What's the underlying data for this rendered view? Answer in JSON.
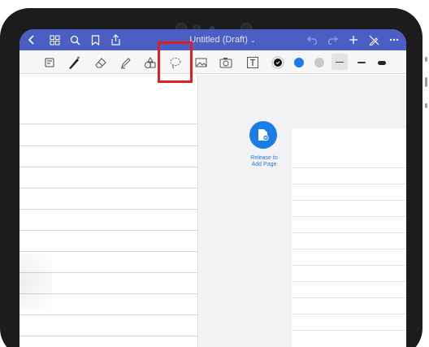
{
  "app": {
    "title": "Untitled (Draft)",
    "accent_color": "#4b5ec3",
    "highlight_color": "#e02020"
  },
  "nav_icons": {
    "back": "chevron-left-icon",
    "thumbnails": "grid-icon",
    "search": "search-icon",
    "bookmark": "bookmark-icon",
    "share": "share-icon"
  },
  "right_icons": {
    "undo": "undo-icon",
    "redo": "redo-icon",
    "add": "plus-icon",
    "edit_off": "pen-off-icon",
    "more": "more-icon"
  },
  "tools": [
    {
      "name": "reading-mode",
      "icon": "reading-mode-icon"
    },
    {
      "name": "pen",
      "icon": "pen-icon",
      "selected": true
    },
    {
      "name": "eraser",
      "icon": "eraser-icon"
    },
    {
      "name": "highlighter",
      "icon": "highlighter-icon"
    },
    {
      "name": "shapes",
      "icon": "shapes-icon"
    },
    {
      "name": "lasso",
      "icon": "lasso-icon",
      "highlighted": true
    },
    {
      "name": "image",
      "icon": "image-icon"
    },
    {
      "name": "camera",
      "icon": "camera-icon"
    },
    {
      "name": "text",
      "icon": "text-tool-icon"
    }
  ],
  "colors": [
    "#111111",
    "#1a7de6",
    "#c8c8c8"
  ],
  "stroke_widths": [
    "thin",
    "medium",
    "thick"
  ],
  "add_page": {
    "label": "Release to\nAdd Page",
    "icon": "add-page-icon"
  }
}
